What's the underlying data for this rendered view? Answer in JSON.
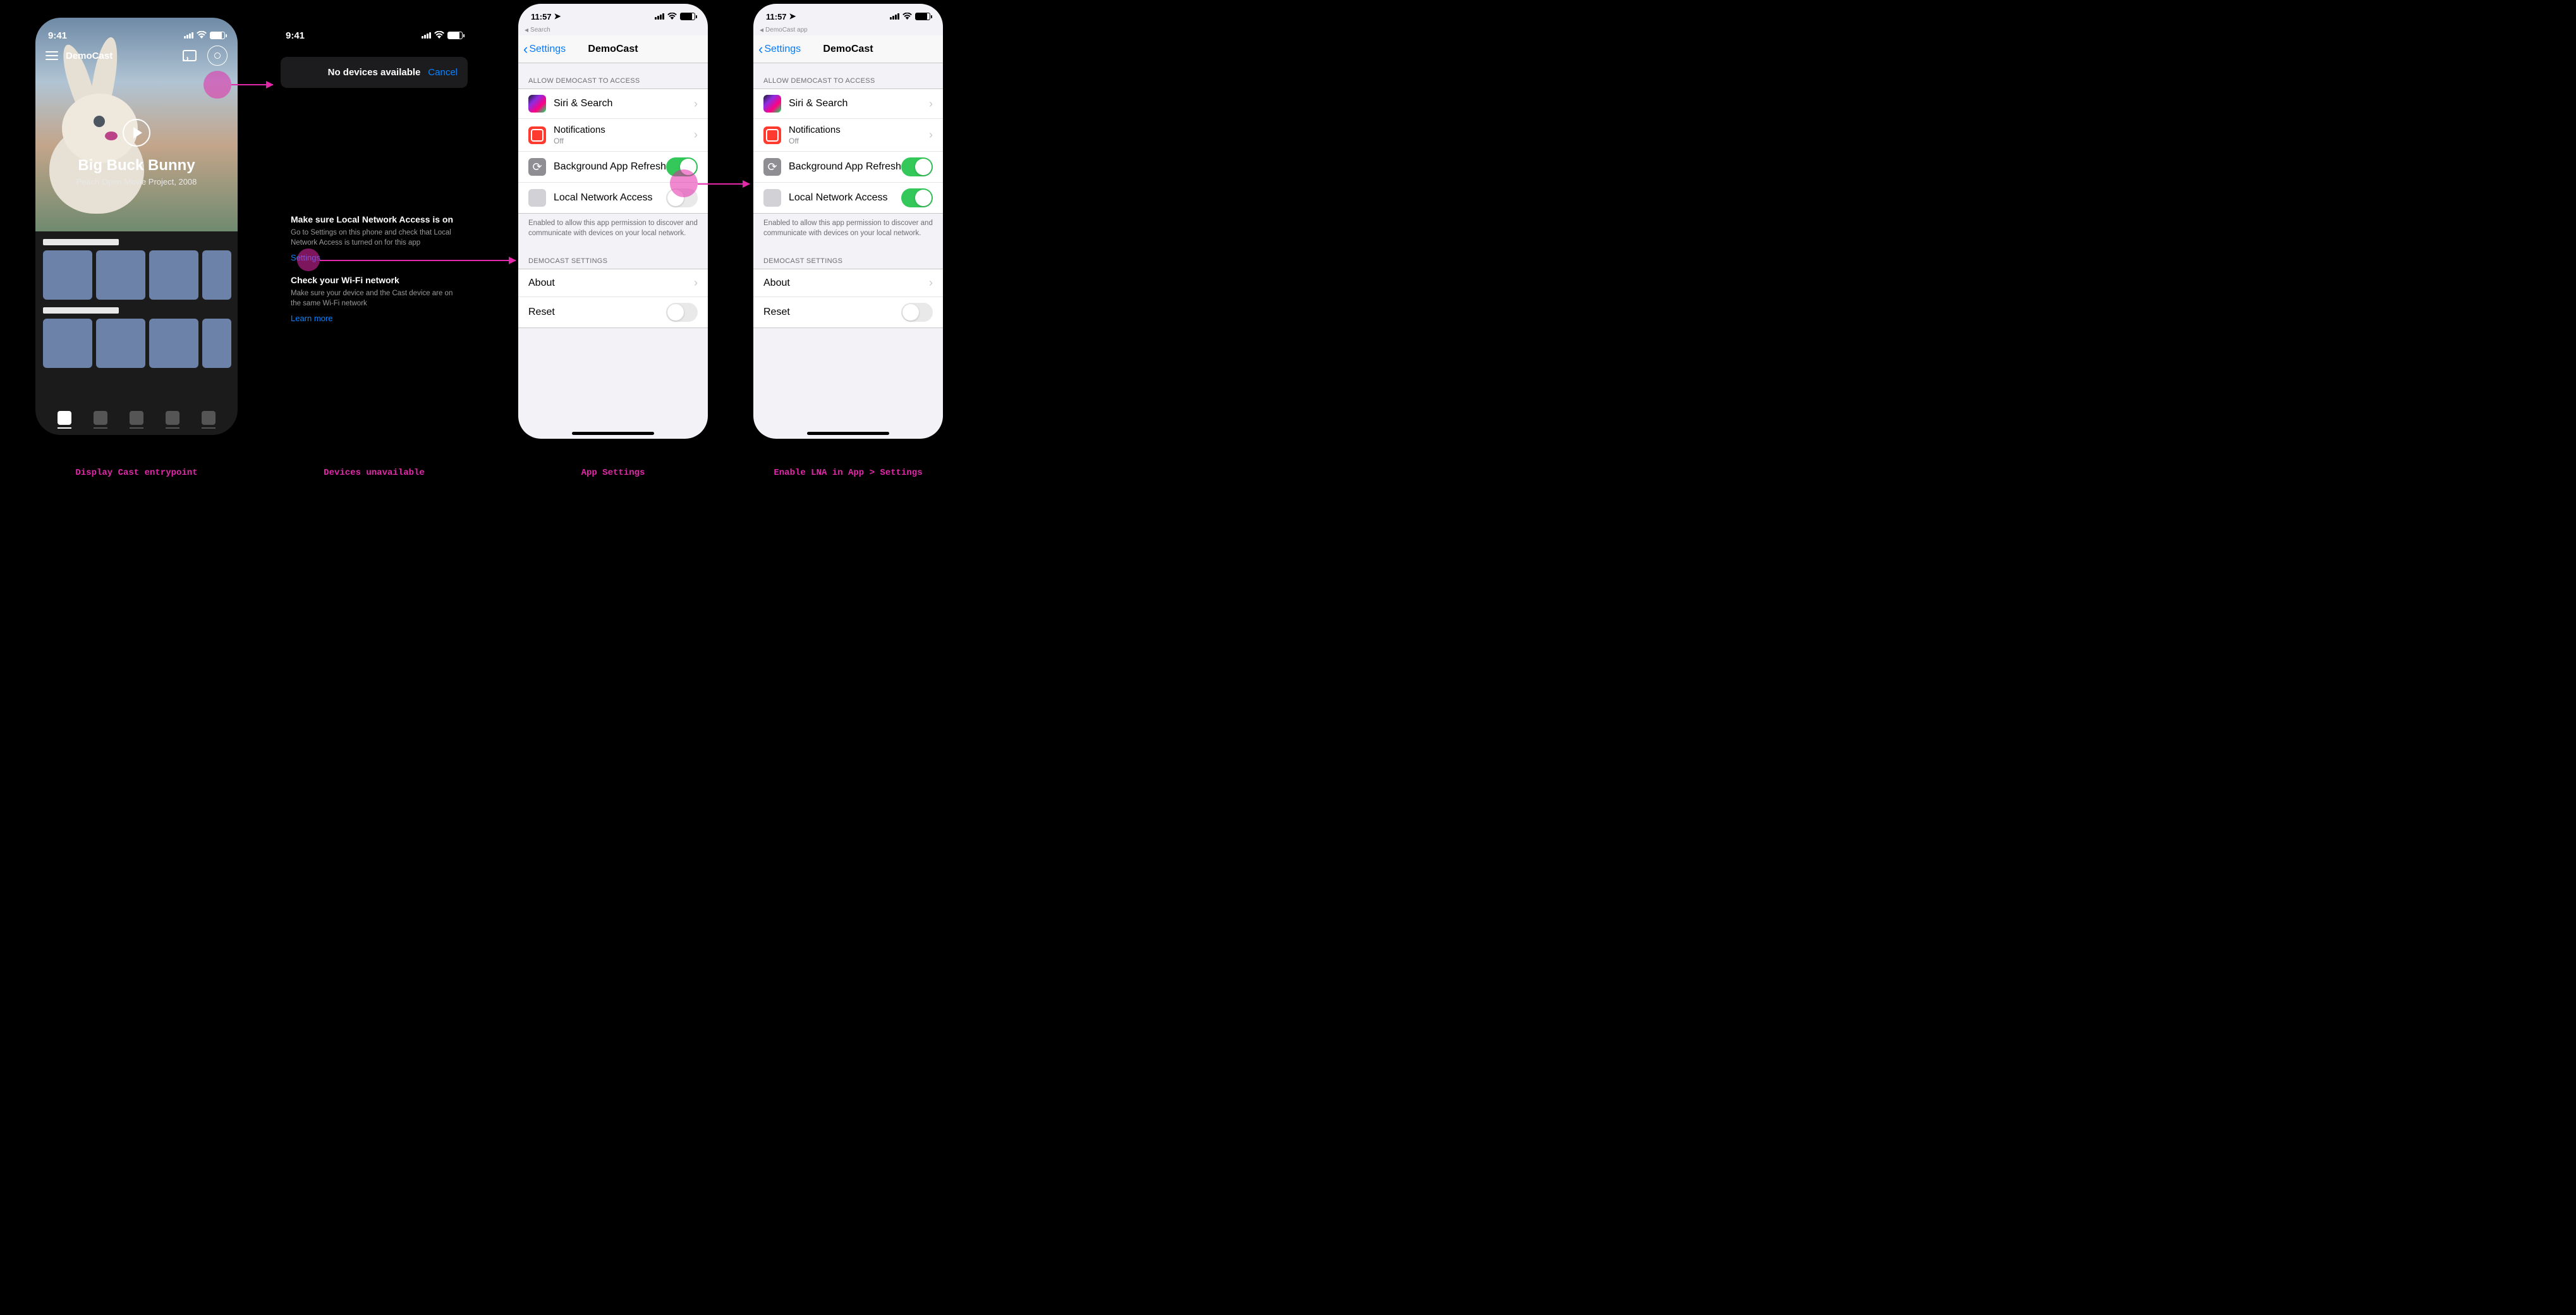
{
  "captions": {
    "p1": "Display Cast entrypoint",
    "p2": "Devices unavailable",
    "p3": "App Settings",
    "p4": "Enable LNA in App > Settings"
  },
  "p1": {
    "time": "9:41",
    "app_name": "DemoCast",
    "video_title": "Big Buck Bunny",
    "video_subtitle": "Peach Open Movie Project, 2008"
  },
  "p2": {
    "time": "9:41",
    "sheet_title": "No devices available",
    "cancel": "Cancel",
    "block1_h": "Make sure Local Network Access is on",
    "block1_p": "Go to Settings on this phone and check that Local Network Access is turned on for this app",
    "settings_link": "Settings",
    "block2_h": "Check your Wi-Fi network",
    "block2_p": "Make sure your device and the Cast device are on the same Wi-Fi network",
    "learn_more": "Learn more"
  },
  "settings_common": {
    "time": "11:57",
    "back_label": "Settings",
    "nav_title": "DemoCast",
    "allow_header": "ALLOW DEMOCAST TO ACCESS",
    "siri": "Siri & Search",
    "notifications": "Notifications",
    "notifications_sub": "Off",
    "bg_refresh": "Background App Refresh",
    "lna": "Local Network Access",
    "lna_footer": "Enabled to allow this app permission to discover and communicate with devices on your local network.",
    "settings_header": "DEMOCAST SETTINGS",
    "about": "About",
    "reset": "Reset"
  },
  "p3": {
    "crumb": "Search",
    "lna_on": false
  },
  "p4": {
    "crumb": "DemoCast app",
    "lna_on": true
  }
}
